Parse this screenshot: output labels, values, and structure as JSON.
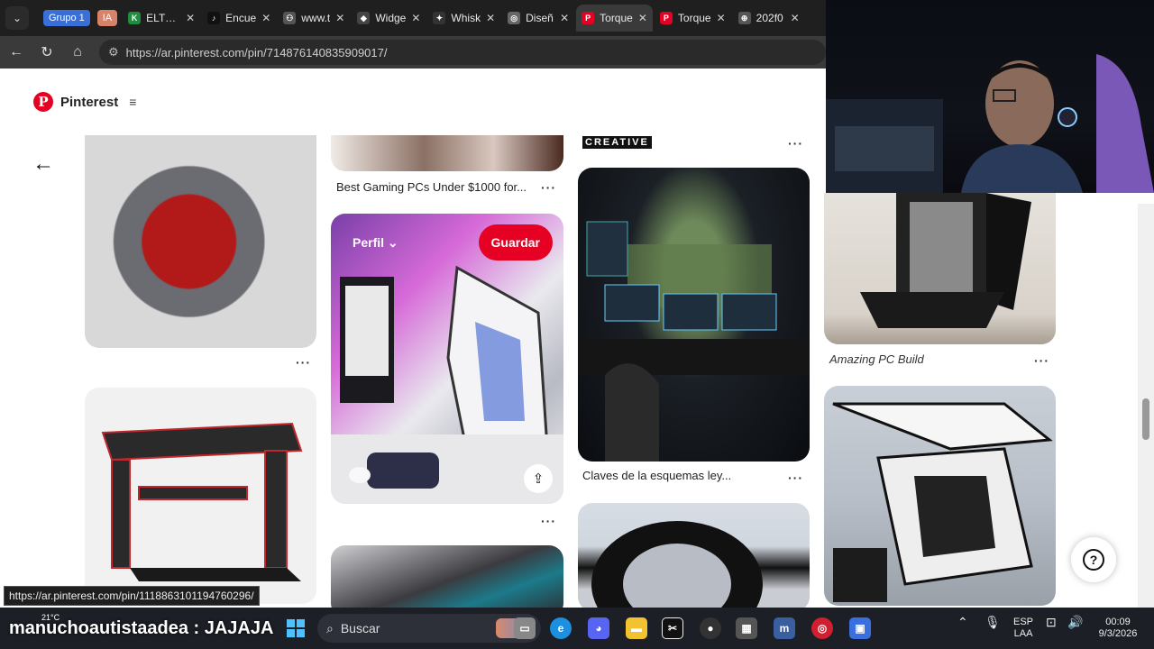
{
  "tabstrip": {
    "groups": [
      {
        "label": "Grupo 1",
        "color": "#3b6fd8"
      },
      {
        "label": "IA",
        "color": "#d9826a"
      }
    ],
    "tabs": [
      {
        "title": "ELTOM",
        "fav_color": "#1e8e3e",
        "fav": "K"
      },
      {
        "title": "Encue",
        "fav_color": "#111111",
        "fav": "♪"
      },
      {
        "title": "www.t",
        "fav_color": "#555555",
        "fav": "⚇"
      },
      {
        "title": "Widge",
        "fav_color": "#444444",
        "fav": "◆"
      },
      {
        "title": "Whisk",
        "fav_color": "#333333",
        "fav": "✦"
      },
      {
        "title": "Diseñ",
        "fav_color": "#666666",
        "fav": "◎"
      },
      {
        "title": "Torque",
        "fav_color": "#e60023",
        "fav": "P",
        "active": true
      },
      {
        "title": "Torque",
        "fav_color": "#e60023",
        "fav": "P"
      },
      {
        "title": "202f0",
        "fav_color": "#555555",
        "fav": "⊕"
      }
    ]
  },
  "address": {
    "url": "https://ar.pinterest.com/pin/714876140835909017/"
  },
  "pinterest": {
    "brand": "Pinterest",
    "creative_label": "CREATIVE",
    "captions": {
      "gaming_pcs": "Best Gaming PCs Under $1000 for...",
      "claves": "Claves de la esquemas ley...",
      "amazing": "Amazing PC Build"
    },
    "profile_label": "Perfil ⌄",
    "save_label": "Guardar",
    "more": "···",
    "help": "?"
  },
  "status_url": "https://ar.pinterest.com/pin/1118863101194760296/",
  "taskbar": {
    "chat": "manuchoautistaadea : JAJAJA",
    "temp": "21°C",
    "search_placeholder": "Buscar",
    "lang_top": "ESP",
    "lang_bottom": "LAA",
    "time": "00:09",
    "date": "9/3/2026"
  }
}
